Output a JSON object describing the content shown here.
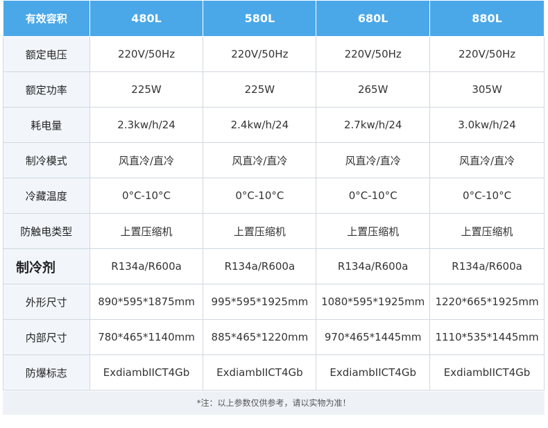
{
  "header": {
    "label": "有效容积",
    "models": [
      "480L",
      "580L",
      "680L",
      "880L"
    ]
  },
  "rows": [
    {
      "label": "额定电压",
      "values": [
        "220V/50Hz",
        "220V/50Hz",
        "220V/50Hz",
        "220V/50Hz"
      ]
    },
    {
      "label": "额定功率",
      "values": [
        "225W",
        "225W",
        "265W",
        "305W"
      ]
    },
    {
      "label": "耗电量",
      "values": [
        "2.3kw/h/24",
        "2.4kw/h/24",
        "2.7kw/h/24",
        "3.0kw/h/24"
      ]
    },
    {
      "label": "制冷模式",
      "values": [
        "风直冷/直冷",
        "风直冷/直冷",
        "风直冷/直冷",
        "风直冷/直冷"
      ]
    },
    {
      "label": "冷藏温度",
      "values": [
        "0°C-10°C",
        "0°C-10°C",
        "0°C-10°C",
        "0°C-10°C"
      ]
    },
    {
      "label": "防触电类型",
      "values": [
        "上置压缩机",
        "上置压缩机",
        "上置压缩机",
        "上置压缩机"
      ]
    },
    {
      "label": "制冷剂",
      "values": [
        "R134a/R600a",
        "R134a/R600a",
        "R134a/R600a",
        "R134a/R600a"
      ]
    },
    {
      "label": "外形尺寸",
      "values": [
        "890*595*1875mm",
        "995*595*1925mm",
        "1080*595*1925mm",
        "1220*665*1925mm"
      ]
    },
    {
      "label": "内部尺寸",
      "values": [
        "780*465*1140mm",
        "885*465*1220mm",
        "970*465*1445mm",
        "1110*535*1445mm"
      ]
    },
    {
      "label": "防爆标志",
      "values": [
        "ExdiambIICT4Gb",
        "ExdiambIICT4Gb",
        "ExdiambIICT4Gb",
        "ExdiambIICT4Gb"
      ]
    }
  ],
  "note": "*注：以上参数仅供参考，请以实物为准！",
  "colors": {
    "header_bg": "#4aa8e8",
    "label_bg": "#f2f6fb",
    "border": "#cfd7e0",
    "note_bg": "#eef2f7"
  }
}
